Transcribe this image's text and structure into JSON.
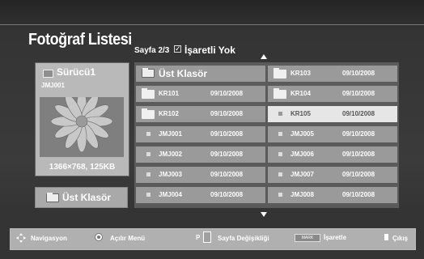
{
  "header": {
    "title": "Fotoğraf Listesi",
    "page_info": "Sayfa 2/3",
    "marked_status": "İşaretli Yok"
  },
  "left_panel": {
    "drive_name": "Sürücü1",
    "file_name": "JMJ001",
    "resolution_info": "1366×768, 125KB",
    "up_folder_button": "Üst Klasör"
  },
  "file_grid": {
    "items": [
      {
        "type": "up-folder",
        "name": "Üst Klasör",
        "date": ""
      },
      {
        "type": "folder",
        "name": "KR103",
        "date": "09/10/2008"
      },
      {
        "type": "folder",
        "name": "KR101",
        "date": "09/10/2008"
      },
      {
        "type": "folder",
        "name": "KR104",
        "date": "09/10/2008"
      },
      {
        "type": "folder",
        "name": "KR102",
        "date": "09/10/2008"
      },
      {
        "type": "file",
        "name": "KR105",
        "date": "09/10/2008",
        "selected": true
      },
      {
        "type": "file",
        "name": "JMJ001",
        "date": "09/10/2008"
      },
      {
        "type": "file",
        "name": "JMJ005",
        "date": "09/10/2008"
      },
      {
        "type": "file",
        "name": "JMJ002",
        "date": "09/10/2008"
      },
      {
        "type": "file",
        "name": "JMJ006",
        "date": "09/10/2008"
      },
      {
        "type": "file",
        "name": "JMJ003",
        "date": "09/10/2008"
      },
      {
        "type": "file",
        "name": "JMJ007",
        "date": "09/10/2008"
      },
      {
        "type": "file",
        "name": "JMJ004",
        "date": "09/10/2008"
      },
      {
        "type": "file",
        "name": "JMJ008",
        "date": "09/10/2008"
      }
    ]
  },
  "footer": {
    "navigation": "Navigasyon",
    "open_menu": "Açılır Menü",
    "page_change_key": "P",
    "page_change": "Sayfa Değişikliği",
    "mark_key": "MARK",
    "mark": "İşaretle",
    "exit": "Çıkış"
  },
  "colors": {
    "background": "#3a3a3a",
    "cell": "#9a9a9a",
    "selected_cell": "#e6e6e6",
    "footer": "#b0b0b0"
  }
}
